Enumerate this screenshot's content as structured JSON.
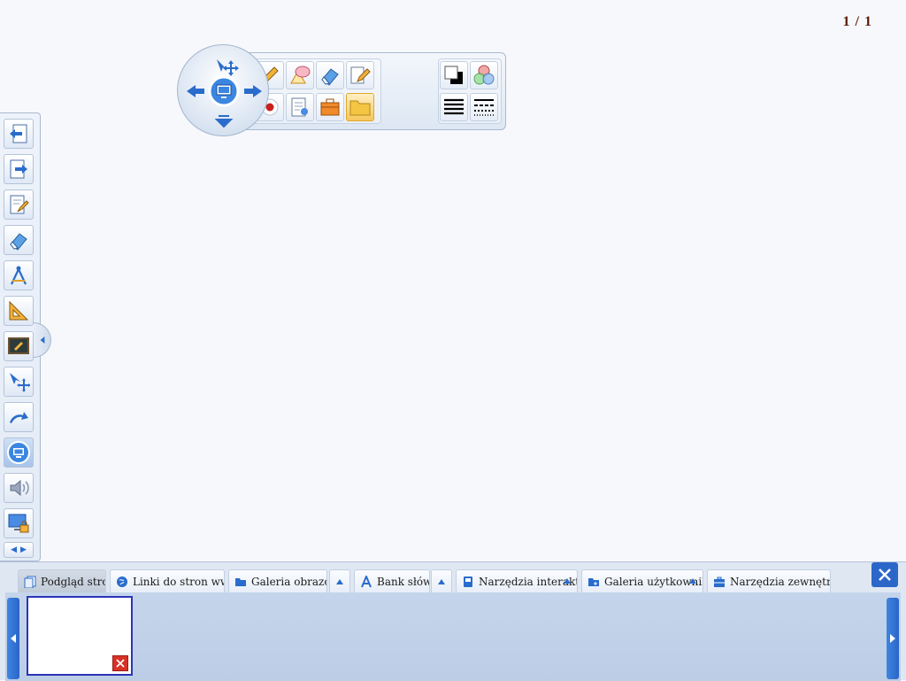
{
  "page_counter": "1 / 1",
  "left_toolbar": {
    "items": [
      {
        "name": "previous-page",
        "icon": "page-back-icon"
      },
      {
        "name": "next-page",
        "icon": "page-forward-icon"
      },
      {
        "name": "page-edit",
        "icon": "page-brush-icon"
      },
      {
        "name": "eraser",
        "icon": "eraser-icon"
      },
      {
        "name": "compass",
        "icon": "compass-icon"
      },
      {
        "name": "ruler-triangle",
        "icon": "triangle-ruler-icon"
      },
      {
        "name": "blackboard",
        "icon": "blackboard-icon"
      },
      {
        "name": "select-move",
        "icon": "select-move-icon"
      },
      {
        "name": "redo",
        "icon": "redo-arrow-icon"
      },
      {
        "name": "display",
        "icon": "monitor-icon"
      },
      {
        "name": "sound",
        "icon": "speaker-icon"
      },
      {
        "name": "screen-lock",
        "icon": "screen-lock-icon"
      }
    ]
  },
  "floating_toolbar": {
    "row1": [
      "new-page-icon",
      "pencil-icon",
      "shapes-icon",
      "eraser-icon",
      "edit-pencil-icon"
    ],
    "row2": [
      "image-icon",
      "record-icon",
      "document-search-icon",
      "toolbox-icon",
      "folder-icon"
    ],
    "active_icon": "folder-icon"
  },
  "bottom_panel": {
    "tabs": [
      {
        "label": "Podgląd stron",
        "icon": "pages-icon"
      },
      {
        "label": "Linki do stron www",
        "icon": "globe-icon"
      },
      {
        "label": "Galeria obrazów",
        "icon": "folder-icon"
      },
      {
        "label": "Bank słów",
        "icon": "letter-a-icon"
      },
      {
        "label": "Narzędzia interaktywne",
        "icon": "interactive-tools-icon"
      },
      {
        "label": "Galeria użytkownika",
        "icon": "user-folder-icon"
      },
      {
        "label": "Narzędzia zewnętrzne",
        "icon": "briefcase-icon"
      }
    ],
    "active_tab": "Podgląd stron"
  },
  "colors": {
    "accent": "#2b67c9",
    "page_counter": "#5b1a08",
    "thumbnail_border": "#2c34b8",
    "delete": "#d83228"
  }
}
